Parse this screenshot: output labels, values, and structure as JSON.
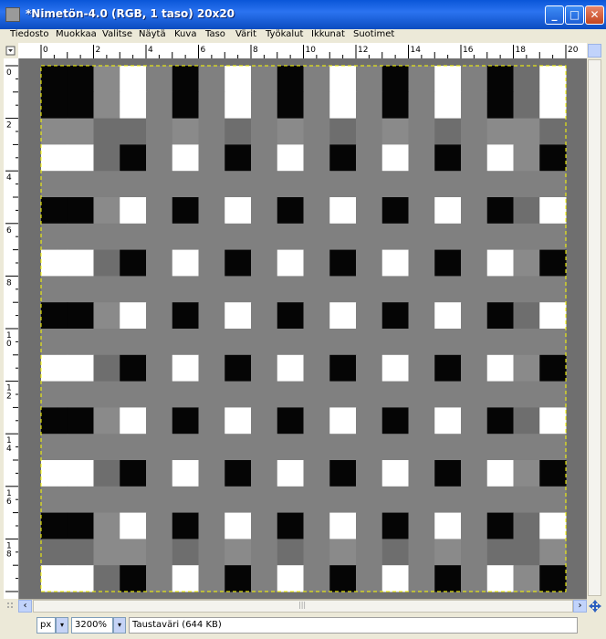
{
  "window": {
    "title": "*Nimetön-4.0 (RGB, 1 taso) 20x20"
  },
  "window_buttons": {
    "minimize": "_",
    "maximize": "□",
    "close": "✕"
  },
  "menu": [
    "Tiedosto",
    "Muokkaa",
    "Valitse",
    "Näytä",
    "Kuva",
    "Taso",
    "Värit",
    "Työkalut",
    "Ikkunat",
    "Suotimet"
  ],
  "ruler": {
    "h_labels": [
      "0",
      "2",
      "4",
      "6",
      "8",
      "10",
      "12",
      "14",
      "16",
      "18",
      "20"
    ],
    "v_labels": [
      "0",
      "2",
      "4",
      "6",
      "8",
      "10",
      "12",
      "14",
      "16",
      "18"
    ]
  },
  "image": {
    "width": 20,
    "height": 20,
    "palette": {
      "K": "#050505",
      "W": "#ffffff",
      "G": "#808080",
      "L": "#8a8a8a",
      "D": "#6e6e6e"
    },
    "rows": [
      "KKLWGKGWGKGWGKGWGKDW",
      "KKLWGKGWGKGWGKGWGKDW",
      "LLDDGLGDGLGDGLGDGLLD",
      "WWDKGWGKGWGKGWGKGWLK",
      "GGGGGGGGGGGGGGGGGGGG",
      "KKLWGKGWGKGWGKGWGKDW",
      "GGGGGGGGGGGGGGGGGGGG",
      "WWDKGWGKGWGKGWGKGWLK",
      "GGGGGGGGGGGGGGGGGGGG",
      "KKLWGKGWGKGWGKGWGKDW",
      "GGGGGGGGGGGGGGGGGGGG",
      "WWDKGWGKGWGKGWGKGWLK",
      "GGGGGGGGGGGGGGGGGGGG",
      "KKLWGKGWGKGWGKGWGKDW",
      "GGGGGGGGGGGGGGGGGGGG",
      "WWDKGWGKGWGKGWGKGWLK",
      "GGGGGGGGGGGGGGGGGGGG",
      "KKLWGKGWGKGWGKGWGKDW",
      "DDLLGDGLGDGLGDGLGDDL",
      "WWDKGWGKGWGKGWGKGWLK"
    ]
  },
  "status": {
    "unit": "px",
    "zoom": "3200%",
    "message": "Taustaväri (644 KB)",
    "dropdown_arrow": "▾"
  },
  "scrollbar": {
    "left_arrow": "‹",
    "right_arrow": "›",
    "up_arrow": "˄",
    "down_arrow": "˅",
    "grip": "|||"
  },
  "colors": {
    "titlebar": "#0a56d8",
    "selection_border": "#ffff00",
    "canvas_bg": "#6f6f6f"
  }
}
